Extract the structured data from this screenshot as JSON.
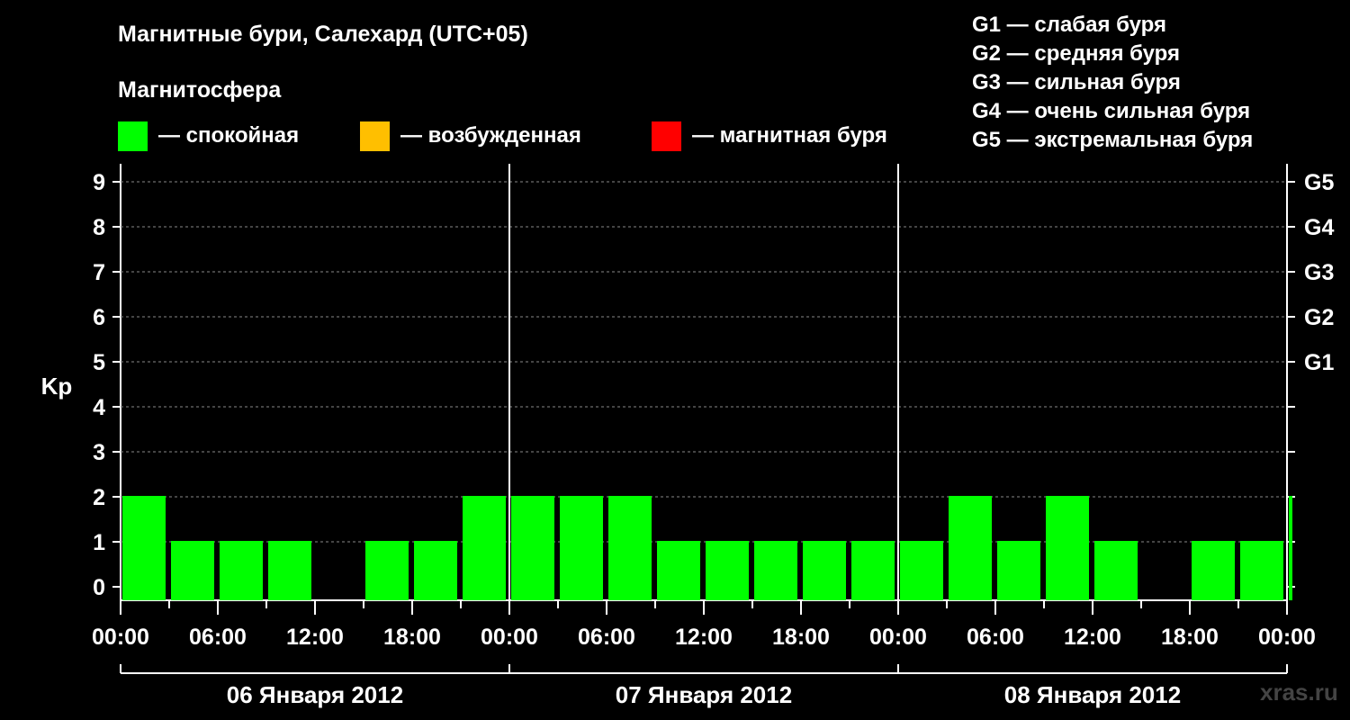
{
  "title": "Магнитные бури, Салехард (UTC+05)",
  "subtitle": "Магнитосфера",
  "legend": [
    {
      "label": "— спокойная",
      "color": "#00ff00"
    },
    {
      "label": "— возбужденная",
      "color": "#ffbf00"
    },
    {
      "label": "— магнитная буря",
      "color": "#ff0000"
    }
  ],
  "g_scale": [
    "G1 — слабая буря",
    "G2 — средняя буря",
    "G3 — сильная буря",
    "G4 — очень сильная буря",
    "G5 — экстремальная буря"
  ],
  "watermark": "xras.ru",
  "chart_data": {
    "type": "bar",
    "ylabel": "Kp",
    "ylim": [
      0,
      9
    ],
    "yticks": [
      "0",
      "1",
      "2",
      "3",
      "4",
      "5",
      "6",
      "7",
      "8",
      "9"
    ],
    "right_ticks": [
      {
        "value": 5,
        "label": "G1"
      },
      {
        "value": 6,
        "label": "G2"
      },
      {
        "value": 7,
        "label": "G3"
      },
      {
        "value": 8,
        "label": "G4"
      },
      {
        "value": 9,
        "label": "G5"
      }
    ],
    "xticks": [
      "00:00",
      "06:00",
      "12:00",
      "18:00",
      "00:00",
      "06:00",
      "12:00",
      "18:00",
      "00:00",
      "06:00",
      "12:00",
      "18:00",
      "00:00"
    ],
    "days": [
      "06 Января 2012",
      "07 Января 2012",
      "08 Января 2012"
    ],
    "bar_interval_hours": 3,
    "values": [
      2,
      1,
      1,
      1,
      0,
      1,
      1,
      2,
      2,
      2,
      2,
      1,
      1,
      1,
      1,
      1,
      1,
      2,
      1,
      2,
      1,
      0,
      1,
      1,
      2
    ],
    "bar_color": "#00ff00",
    "grid": true
  }
}
